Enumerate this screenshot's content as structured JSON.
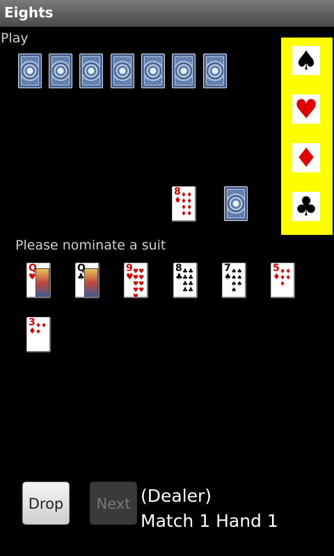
{
  "app": {
    "title": "Eights"
  },
  "play_label": "Play",
  "opponent": {
    "card_count": 7
  },
  "table": {
    "discard": {
      "rank": "8",
      "suit": "♦",
      "color": "red"
    },
    "stock": "card-back"
  },
  "suit_panel": {
    "options": [
      {
        "suit": "♠",
        "color": "black"
      },
      {
        "suit": "♥",
        "color": "red"
      },
      {
        "suit": "♦",
        "color": "red"
      },
      {
        "suit": "♣",
        "color": "black"
      }
    ]
  },
  "prompt": "Please nominate a suit",
  "hand": [
    {
      "rank": "Q",
      "suit": "♥",
      "color": "red"
    },
    {
      "rank": "Q",
      "suit": "♣",
      "color": "black"
    },
    {
      "rank": "9",
      "suit": "♥",
      "color": "red"
    },
    {
      "rank": "8",
      "suit": "♣",
      "color": "black"
    },
    {
      "rank": "7",
      "suit": "♠",
      "color": "black"
    },
    {
      "rank": "5",
      "suit": "♦",
      "color": "red"
    },
    {
      "rank": "3",
      "suit": "♦",
      "color": "red"
    }
  ],
  "buttons": {
    "drop": "Drop",
    "next": "Next"
  },
  "status": {
    "role": "(Dealer)",
    "match": "Match 1 Hand 1"
  }
}
